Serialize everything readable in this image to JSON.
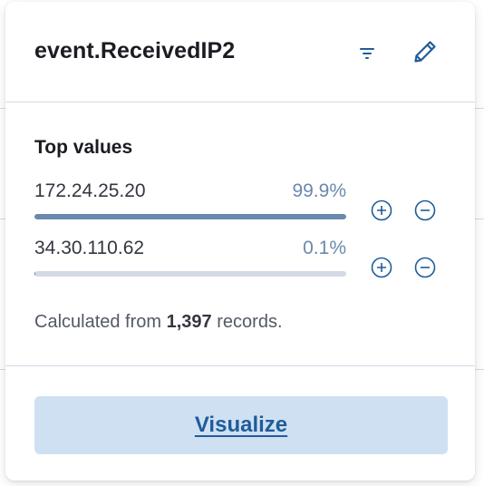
{
  "popover": {
    "title": "event.ReceivedIP2",
    "filter_icon": "filter-icon",
    "edit_icon": "pencil-icon"
  },
  "top_values": {
    "heading": "Top values",
    "rows": [
      {
        "value": "172.24.25.20",
        "percent_label": "99.9%",
        "fraction": 0.999
      },
      {
        "value": "34.30.110.62",
        "percent_label": "0.1%",
        "fraction": 0.001
      }
    ],
    "add_icon": "plus-in-circle-icon",
    "remove_icon": "minus-in-circle-icon"
  },
  "footnote": {
    "prefix": "Calculated from",
    "count": "1,397",
    "suffix": "records."
  },
  "footer": {
    "visualize_label": "Visualize"
  },
  "colors": {
    "accent": "#6a89ad",
    "track": "#d3dae6",
    "button_bg": "#cfe0f2",
    "link": "#1f5c99",
    "icon": "#1f5c99"
  }
}
